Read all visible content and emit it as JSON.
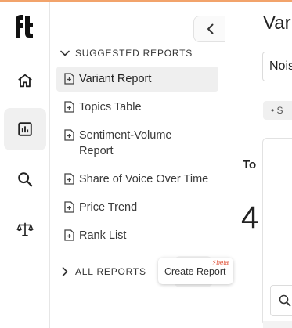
{
  "sidebar_rail": {
    "items": [
      {
        "name": "home-icon",
        "active": false
      },
      {
        "name": "reports-icon",
        "active": true
      },
      {
        "name": "search-icon",
        "active": false
      },
      {
        "name": "scale-icon",
        "active": false
      }
    ]
  },
  "reports_panel": {
    "suggested_header": "SUGGESTED REPORTS",
    "suggested": [
      {
        "label": "Variant Report",
        "selected": true
      },
      {
        "label": "Topics Table",
        "selected": false
      },
      {
        "label": "Sentiment-Volume Report",
        "selected": false
      },
      {
        "label": "Share of Voice Over Time",
        "selected": false
      },
      {
        "label": "Price Trend",
        "selected": false
      },
      {
        "label": "Rank List",
        "selected": false
      }
    ],
    "all_header": "ALL REPORTS",
    "create_tooltip": {
      "badge": "⚡beta",
      "label": "Create Report"
    }
  },
  "main": {
    "title": "Var",
    "dropdown_value": "Nois",
    "chip_text": "• S",
    "card_title": "To",
    "card_value": "4"
  },
  "colors": {
    "accent": "#f2a36b",
    "beta": "#e0533a",
    "selected_bg": "#efefef"
  }
}
